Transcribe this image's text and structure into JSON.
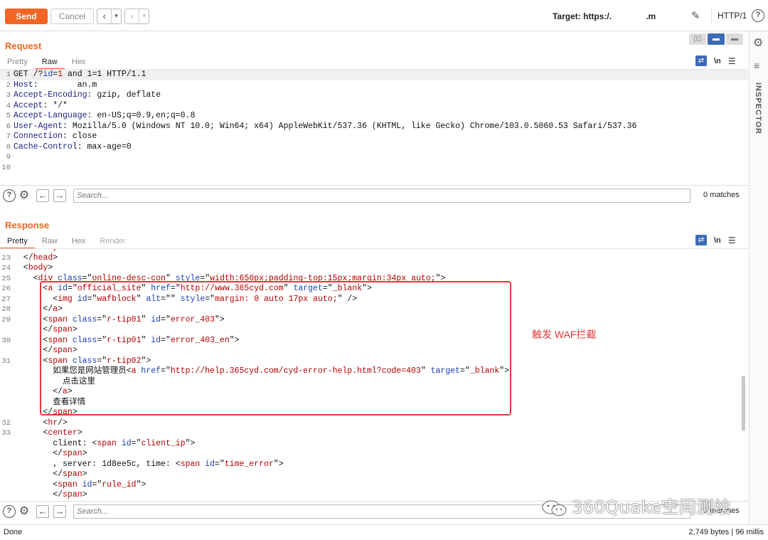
{
  "toolbar": {
    "send_label": "Send",
    "cancel_label": "Cancel",
    "target_label": "Target: https:/.",
    "target_tail": ".m",
    "http_version": "HTTP/1"
  },
  "request": {
    "title": "Request",
    "tabs": [
      "Pretty",
      "Raw",
      "Hex"
    ],
    "active_tab": "Raw",
    "newline_label": "\\n",
    "search_placeholder": "Search...",
    "matches": "0 matches"
  },
  "response": {
    "title": "Response",
    "tabs": [
      "Pretty",
      "Raw",
      "Hex",
      "Render"
    ],
    "active_tab": "Pretty",
    "newline_label": "\\n",
    "search_placeholder": "Search...",
    "matches": "0 matches"
  },
  "sidebar": {
    "inspector_label": "INSPECTOR"
  },
  "annotation": {
    "text": "触发 WAF拦截"
  },
  "status": {
    "left": "Done",
    "right": "2,749 bytes | 96 millis"
  },
  "watermark": {
    "text": "360Quake空间测绘"
  }
}
